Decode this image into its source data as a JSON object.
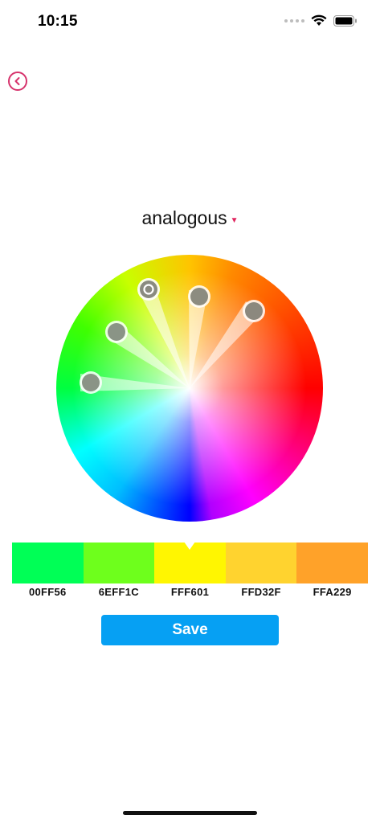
{
  "status_bar": {
    "time": "10:15"
  },
  "scheme": {
    "label": "analogous"
  },
  "palette": [
    {
      "hex": "00FF56",
      "color": "#00FF56"
    },
    {
      "hex": "6EFF1C",
      "color": "#6EFF1C"
    },
    {
      "hex": "FFF601",
      "color": "#FFF601",
      "selected": true
    },
    {
      "hex": "FFD32F",
      "color": "#FFD32F"
    },
    {
      "hex": "FFA229",
      "color": "#FFA229"
    }
  ],
  "actions": {
    "save_label": "Save"
  },
  "colors": {
    "accent": "#D6336C",
    "save_button": "#06A0F3"
  }
}
